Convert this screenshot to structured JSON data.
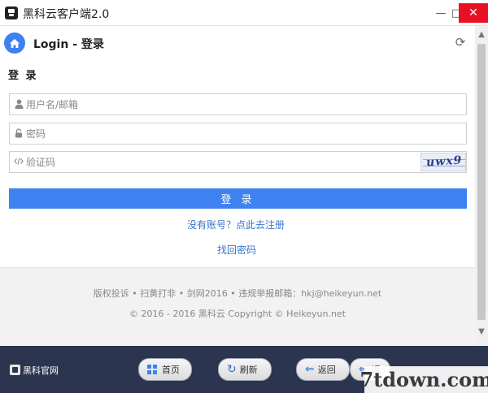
{
  "window": {
    "title": "黑科云客户端2.0",
    "minimize": "—",
    "maximize": "□",
    "close": "✕"
  },
  "header": {
    "title": "Login - 登录",
    "refresh_glyph": "⟳",
    "accent_color": "#3d82f0"
  },
  "form": {
    "section_label": "登 录",
    "username_placeholder": "用户名/邮箱",
    "password_placeholder": "密码",
    "captcha_placeholder": "验证码",
    "captcha_text": "uwx9",
    "login_button": "登 录",
    "register_link": "没有账号？点此去注册",
    "recover_link": "找回密码"
  },
  "footer": {
    "line1": "版权投诉 • 扫黄打非 • 剑网2016 • 违规举报邮箱：hkj@heikeyun.net",
    "line2": "© 2016 - 2016 黑科云 Copyright © Heikeyun.net"
  },
  "taskbar": {
    "official_site": "黑科官网",
    "home": "首页",
    "refresh": "刷新",
    "back": "返回",
    "forward": "返"
  },
  "watermark": "7tdown.com"
}
